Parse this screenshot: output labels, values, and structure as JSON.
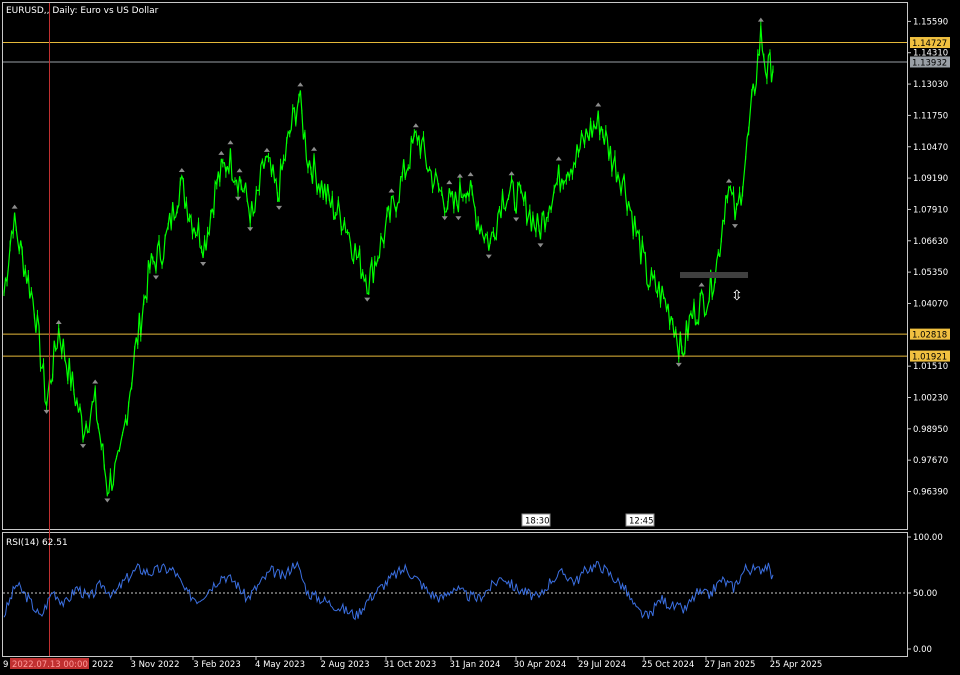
{
  "chart_data": [
    {
      "type": "line",
      "title": "EURUSD,, Daily:  Euro vs US Dollar",
      "symbol": "EURUSD",
      "timeframe": "Daily",
      "ylim": [
        0.949,
        1.163
      ],
      "y_ticks": [
        "1.15590",
        "1.14310",
        "1.13030",
        "1.11750",
        "1.10470",
        "1.09190",
        "1.07910",
        "1.06630",
        "1.05350",
        "1.04070",
        "1.02818",
        "1.01510",
        "1.00230",
        "0.98950",
        "0.97670",
        "0.96390"
      ],
      "x_ticks": [
        "3 Nov 2022",
        "3 Feb 2023",
        "4 May 2023",
        "2 Aug 2023",
        "31 Oct 2023",
        "31 Jan 2024",
        "30 Apr 2024",
        "29 Jul 2024",
        "25 Oct 2024",
        "27 Jan 2025",
        "25 Apr 2025"
      ],
      "x_tick_left_partial": "9",
      "x_tick_partial_2": "2022",
      "price_series_color": "#00ff00",
      "fractal_marker_color": "#8c8c8c",
      "current_price": "1.13932",
      "horizontal_levels": [
        {
          "value": "1.14727",
          "color": "#e5b93a",
          "label_bg": "#f0c040"
        },
        {
          "value": "1.02818",
          "color": "#e5b93a",
          "label_bg": "#f0c040"
        },
        {
          "value": "1.01921",
          "color": "#e5b93a",
          "label_bg": "#f0c040"
        },
        {
          "value": "1.13932",
          "color": "#9aa0a6",
          "label_bg": "#9aa0a6"
        }
      ],
      "vertical_line": {
        "color": "#c03030",
        "label": "2022.07.13 00:00"
      },
      "time_markers": [
        "18:30",
        "12:45"
      ],
      "series_approx": [
        {
          "t": 0,
          "v": 1.045
        },
        {
          "t": 3,
          "v": 1.075
        },
        {
          "t": 6,
          "v": 1.06
        },
        {
          "t": 10,
          "v": 1.04
        },
        {
          "t": 14,
          "v": 1.0
        },
        {
          "t": 18,
          "v": 1.03
        },
        {
          "t": 22,
          "v": 1.01
        },
        {
          "t": 26,
          "v": 0.99
        },
        {
          "t": 30,
          "v": 1.0
        },
        {
          "t": 34,
          "v": 0.966
        },
        {
          "t": 38,
          "v": 0.975
        },
        {
          "t": 43,
          "v": 1.02
        },
        {
          "t": 48,
          "v": 1.055
        },
        {
          "t": 53,
          "v": 1.065
        },
        {
          "t": 58,
          "v": 1.09
        },
        {
          "t": 62,
          "v": 1.075
        },
        {
          "t": 66,
          "v": 1.065
        },
        {
          "t": 70,
          "v": 1.09
        },
        {
          "t": 74,
          "v": 1.1
        },
        {
          "t": 78,
          "v": 1.09
        },
        {
          "t": 82,
          "v": 1.075
        },
        {
          "t": 86,
          "v": 1.1
        },
        {
          "t": 90,
          "v": 1.085
        },
        {
          "t": 94,
          "v": 1.11
        },
        {
          "t": 97,
          "v": 1.125
        },
        {
          "t": 100,
          "v": 1.1
        },
        {
          "t": 104,
          "v": 1.09
        },
        {
          "t": 108,
          "v": 1.08
        },
        {
          "t": 112,
          "v": 1.075
        },
        {
          "t": 116,
          "v": 1.06
        },
        {
          "t": 120,
          "v": 1.05
        },
        {
          "t": 124,
          "v": 1.065
        },
        {
          "t": 128,
          "v": 1.08
        },
        {
          "t": 132,
          "v": 1.095
        },
        {
          "t": 136,
          "v": 1.11
        },
        {
          "t": 140,
          "v": 1.095
        },
        {
          "t": 144,
          "v": 1.085
        },
        {
          "t": 148,
          "v": 1.08
        },
        {
          "t": 152,
          "v": 1.09
        },
        {
          "t": 156,
          "v": 1.075
        },
        {
          "t": 160,
          "v": 1.065
        },
        {
          "t": 164,
          "v": 1.085
        },
        {
          "t": 168,
          "v": 1.085
        },
        {
          "t": 172,
          "v": 1.08
        },
        {
          "t": 176,
          "v": 1.07
        },
        {
          "t": 180,
          "v": 1.085
        },
        {
          "t": 184,
          "v": 1.095
        },
        {
          "t": 188,
          "v": 1.1
        },
        {
          "t": 192,
          "v": 1.11
        },
        {
          "t": 196,
          "v": 1.115
        },
        {
          "t": 200,
          "v": 1.1
        },
        {
          "t": 204,
          "v": 1.09
        },
        {
          "t": 208,
          "v": 1.07
        },
        {
          "t": 212,
          "v": 1.05
        },
        {
          "t": 216,
          "v": 1.045
        },
        {
          "t": 220,
          "v": 1.035
        },
        {
          "t": 223,
          "v": 1.02
        },
        {
          "t": 226,
          "v": 1.035
        },
        {
          "t": 229,
          "v": 1.04
        },
        {
          "t": 232,
          "v": 1.045
        },
        {
          "t": 235,
          "v": 1.06
        },
        {
          "t": 238,
          "v": 1.09
        },
        {
          "t": 241,
          "v": 1.075
        },
        {
          "t": 244,
          "v": 1.1
        },
        {
          "t": 247,
          "v": 1.13
        },
        {
          "t": 249,
          "v": 1.15
        },
        {
          "t": 251,
          "v": 1.135
        },
        {
          "t": 253,
          "v": 1.139
        }
      ]
    },
    {
      "type": "line",
      "title": "RSI(14) 62.51",
      "indicator": "RSI(14)",
      "last_value": "62.51",
      "ylim": [
        0,
        100
      ],
      "y_ticks": [
        "100.00",
        "50.00",
        "0.00"
      ],
      "level_line": 50,
      "series_color": "#3b6fe0",
      "series_approx": [
        {
          "t": 0,
          "v": 30
        },
        {
          "t": 4,
          "v": 58
        },
        {
          "t": 8,
          "v": 45
        },
        {
          "t": 12,
          "v": 28
        },
        {
          "t": 16,
          "v": 52
        },
        {
          "t": 20,
          "v": 40
        },
        {
          "t": 24,
          "v": 55
        },
        {
          "t": 28,
          "v": 45
        },
        {
          "t": 32,
          "v": 58
        },
        {
          "t": 36,
          "v": 48
        },
        {
          "t": 40,
          "v": 62
        },
        {
          "t": 44,
          "v": 72
        },
        {
          "t": 48,
          "v": 68
        },
        {
          "t": 52,
          "v": 72
        },
        {
          "t": 56,
          "v": 70
        },
        {
          "t": 60,
          "v": 50
        },
        {
          "t": 64,
          "v": 44
        },
        {
          "t": 68,
          "v": 55
        },
        {
          "t": 72,
          "v": 66
        },
        {
          "t": 76,
          "v": 60
        },
        {
          "t": 80,
          "v": 45
        },
        {
          "t": 84,
          "v": 58
        },
        {
          "t": 88,
          "v": 70
        },
        {
          "t": 92,
          "v": 64
        },
        {
          "t": 96,
          "v": 78
        },
        {
          "t": 100,
          "v": 50
        },
        {
          "t": 104,
          "v": 45
        },
        {
          "t": 108,
          "v": 40
        },
        {
          "t": 112,
          "v": 35
        },
        {
          "t": 116,
          "v": 30
        },
        {
          "t": 120,
          "v": 45
        },
        {
          "t": 124,
          "v": 55
        },
        {
          "t": 128,
          "v": 65
        },
        {
          "t": 132,
          "v": 72
        },
        {
          "t": 136,
          "v": 62
        },
        {
          "t": 140,
          "v": 50
        },
        {
          "t": 144,
          "v": 45
        },
        {
          "t": 148,
          "v": 55
        },
        {
          "t": 152,
          "v": 48
        },
        {
          "t": 156,
          "v": 45
        },
        {
          "t": 160,
          "v": 55
        },
        {
          "t": 164,
          "v": 65
        },
        {
          "t": 168,
          "v": 55
        },
        {
          "t": 172,
          "v": 50
        },
        {
          "t": 176,
          "v": 45
        },
        {
          "t": 180,
          "v": 62
        },
        {
          "t": 184,
          "v": 68
        },
        {
          "t": 188,
          "v": 60
        },
        {
          "t": 192,
          "v": 72
        },
        {
          "t": 196,
          "v": 75
        },
        {
          "t": 200,
          "v": 65
        },
        {
          "t": 204,
          "v": 55
        },
        {
          "t": 208,
          "v": 35
        },
        {
          "t": 212,
          "v": 28
        },
        {
          "t": 216,
          "v": 45
        },
        {
          "t": 220,
          "v": 38
        },
        {
          "t": 224,
          "v": 35
        },
        {
          "t": 228,
          "v": 50
        },
        {
          "t": 232,
          "v": 48
        },
        {
          "t": 236,
          "v": 62
        },
        {
          "t": 240,
          "v": 55
        },
        {
          "t": 244,
          "v": 72
        },
        {
          "t": 248,
          "v": 70
        },
        {
          "t": 251,
          "v": 75
        },
        {
          "t": 253,
          "v": 62.51
        }
      ]
    }
  ]
}
